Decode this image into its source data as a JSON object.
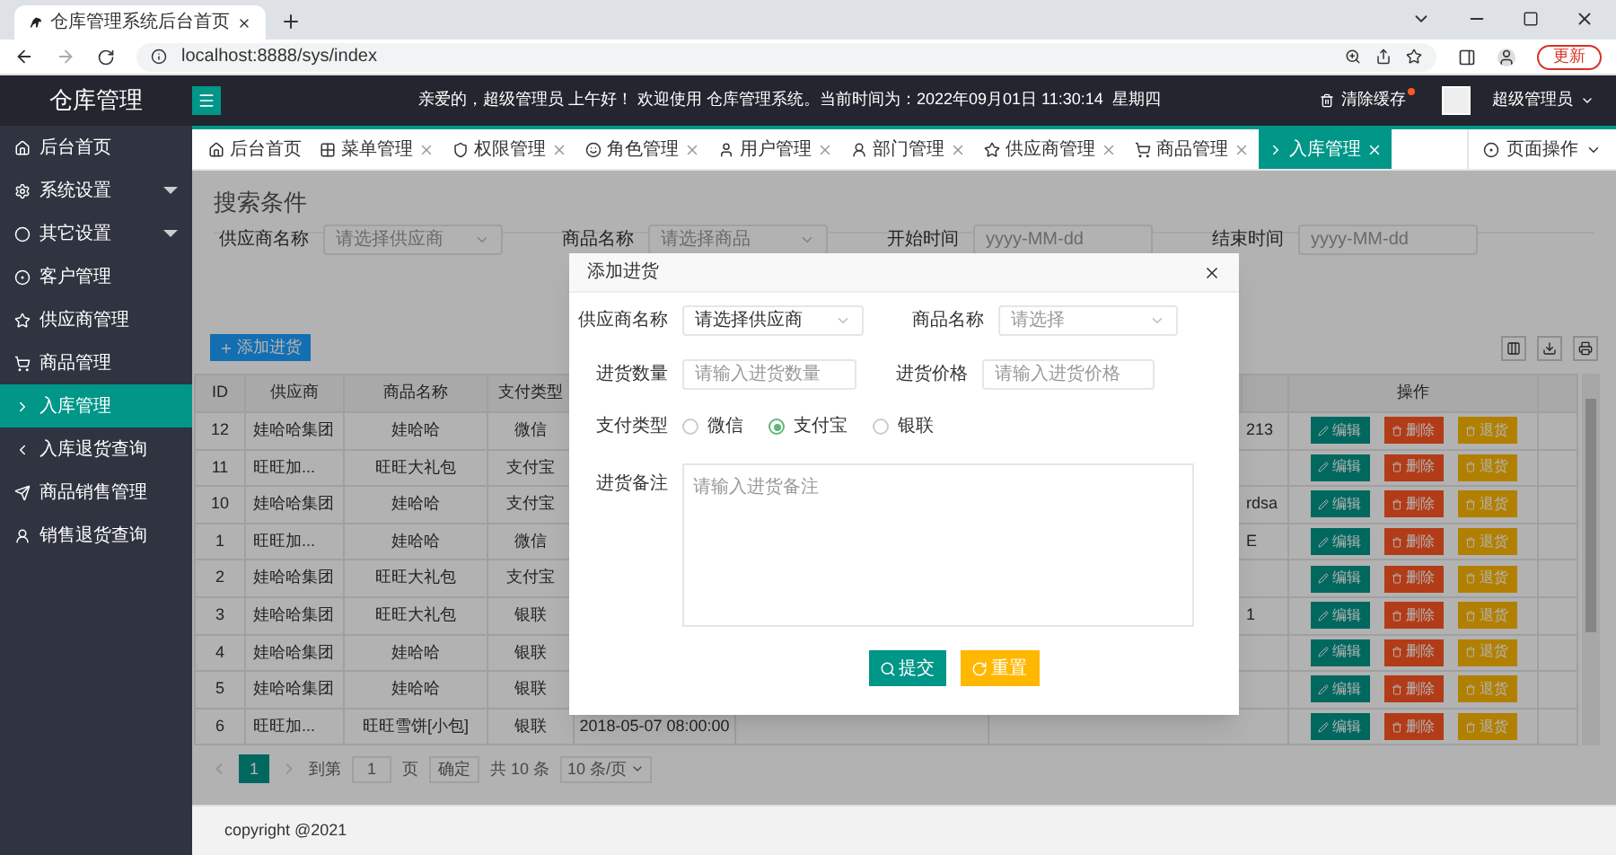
{
  "browser": {
    "tab_title": "仓库管理系统后台首页",
    "url": "localhost:8888/sys/index",
    "update_button": "更新"
  },
  "header": {
    "logo": "仓库管理",
    "greeting": "亲爱的，超级管理员 上午好！ 欢迎使用 仓库管理系统。当前时间为：2022年09月01日 11:30:14  星期四",
    "clear_cache": "清除缓存",
    "user": "超级管理员"
  },
  "sidebar": {
    "items": [
      {
        "label": "后台首页",
        "selected": false,
        "has_submenu": false
      },
      {
        "label": "系统设置",
        "selected": false,
        "has_submenu": true
      },
      {
        "label": "其它设置",
        "selected": false,
        "has_submenu": true
      },
      {
        "label": "客户管理",
        "selected": false,
        "has_submenu": false
      },
      {
        "label": "供应商管理",
        "selected": false,
        "has_submenu": false
      },
      {
        "label": "商品管理",
        "selected": false,
        "has_submenu": false
      },
      {
        "label": "入库管理",
        "selected": true,
        "has_submenu": false
      },
      {
        "label": "入库退货查询",
        "selected": false,
        "has_submenu": false
      },
      {
        "label": "商品销售管理",
        "selected": false,
        "has_submenu": false
      },
      {
        "label": "销售退货查询",
        "selected": false,
        "has_submenu": false
      }
    ]
  },
  "tabs": [
    {
      "label": "后台首页",
      "selected": false,
      "closable": false
    },
    {
      "label": "菜单管理",
      "selected": false,
      "closable": true
    },
    {
      "label": "权限管理",
      "selected": false,
      "closable": true
    },
    {
      "label": "角色管理",
      "selected": false,
      "closable": true
    },
    {
      "label": "用户管理",
      "selected": false,
      "closable": true
    },
    {
      "label": "部门管理",
      "selected": false,
      "closable": true
    },
    {
      "label": "供应商管理",
      "selected": false,
      "closable": true
    },
    {
      "label": "商品管理",
      "selected": false,
      "closable": true
    },
    {
      "label": "入库管理",
      "selected": true,
      "closable": true
    }
  ],
  "page_actions": "页面操作",
  "search": {
    "title": "搜索条件",
    "fields": [
      {
        "label": "供应商名称",
        "placeholder": "请选择供应商",
        "kind": "select"
      },
      {
        "label": "商品名称",
        "placeholder": "请选择商品",
        "kind": "select"
      },
      {
        "label": "开始时间",
        "placeholder": "yyyy-MM-dd",
        "kind": "date"
      },
      {
        "label": "结束时间",
        "placeholder": "yyyy-MM-dd",
        "kind": "date"
      }
    ]
  },
  "add_button": "添加进货",
  "table": {
    "columns": [
      "ID",
      "供应商",
      "商品名称",
      "支付类型",
      "操作"
    ],
    "rows": [
      {
        "id": "12",
        "supplier": "娃哈哈集团",
        "goods": "娃哈哈",
        "pay_type": "微信",
        "column_8": "213",
        "actions": [
          {
            "kind": "edit",
            "label": "编辑"
          },
          {
            "kind": "delete",
            "label": "删除"
          },
          {
            "kind": "return",
            "label": "退货"
          }
        ]
      },
      {
        "id": "11",
        "supplier": "旺旺加...",
        "goods": "旺旺大礼包",
        "pay_type": "支付宝",
        "actions": [
          {
            "kind": "edit",
            "label": "编辑"
          },
          {
            "kind": "delete",
            "label": "删除"
          },
          {
            "kind": "return",
            "label": "退货"
          }
        ]
      },
      {
        "id": "10",
        "supplier": "娃哈哈集团",
        "goods": "娃哈哈",
        "pay_type": "支付宝",
        "column_8": "rdsa",
        "actions": [
          {
            "kind": "edit",
            "label": "编辑"
          },
          {
            "kind": "delete",
            "label": "删除"
          },
          {
            "kind": "return",
            "label": "退货"
          }
        ]
      },
      {
        "id": "1",
        "supplier": "旺旺加...",
        "goods": "娃哈哈",
        "pay_type": "微信",
        "column_8": "E",
        "actions": [
          {
            "kind": "edit",
            "label": "编辑"
          },
          {
            "kind": "delete",
            "label": "删除"
          },
          {
            "kind": "return",
            "label": "退货"
          }
        ]
      },
      {
        "id": "2",
        "supplier": "娃哈哈集团",
        "goods": "旺旺大礼包",
        "pay_type": "支付宝",
        "actions": [
          {
            "kind": "edit",
            "label": "编辑"
          },
          {
            "kind": "delete",
            "label": "删除"
          },
          {
            "kind": "return",
            "label": "退货"
          }
        ]
      },
      {
        "id": "3",
        "supplier": "娃哈哈集团",
        "goods": "旺旺大礼包",
        "pay_type": "银联",
        "column_8": "1",
        "actions": [
          {
            "kind": "edit",
            "label": "编辑"
          },
          {
            "kind": "delete",
            "label": "删除"
          },
          {
            "kind": "return",
            "label": "退货"
          }
        ]
      },
      {
        "id": "4",
        "supplier": "娃哈哈集团",
        "goods": "娃哈哈",
        "pay_type": "银联",
        "actions": [
          {
            "kind": "edit",
            "label": "编辑"
          },
          {
            "kind": "delete",
            "label": "删除"
          },
          {
            "kind": "return",
            "label": "退货"
          }
        ]
      },
      {
        "id": "5",
        "supplier": "娃哈哈集团",
        "goods": "娃哈哈",
        "pay_type": "银联",
        "actions": [
          {
            "kind": "edit",
            "label": "编辑"
          },
          {
            "kind": "delete",
            "label": "删除"
          },
          {
            "kind": "return",
            "label": "退货"
          }
        ]
      },
      {
        "id": "6",
        "supplier": "旺旺加...",
        "goods": "旺旺雪饼[小包]",
        "pay_type": "银联",
        "column_5": "2018-05-07 08:00:00",
        "actions": [
          {
            "kind": "edit",
            "label": "编辑"
          },
          {
            "kind": "delete",
            "label": "删除"
          },
          {
            "kind": "return",
            "label": "退货"
          }
        ]
      }
    ]
  },
  "pagination": {
    "pages": [
      {
        "label": "1",
        "selected": true
      }
    ],
    "goto_label": "到第",
    "goto_value": "1",
    "page_unit": "页",
    "confirm": "确定",
    "total": "共 10 条",
    "page_size": "10 条/页"
  },
  "modal": {
    "title": "添加进货",
    "fields": [
      {
        "label": "供应商名称",
        "value": "请选择供应商",
        "kind": "select"
      },
      {
        "label": "商品名称",
        "placeholder": "请选择",
        "kind": "select"
      },
      {
        "label": "进货数量",
        "placeholder": "请输入进货数量",
        "kind": "input"
      },
      {
        "label": "进货价格",
        "placeholder": "请输入进货价格",
        "kind": "input"
      }
    ],
    "pay_label": "支付类型",
    "pay_options": [
      {
        "label": "微信",
        "selected": false
      },
      {
        "label": "支付宝",
        "selected": true
      },
      {
        "label": "银联",
        "selected": false
      }
    ],
    "note_label": "进货备注",
    "note_placeholder": "请输入进货备注",
    "submit": "提交",
    "reset": "重置"
  },
  "footer": "copyright @2021"
}
